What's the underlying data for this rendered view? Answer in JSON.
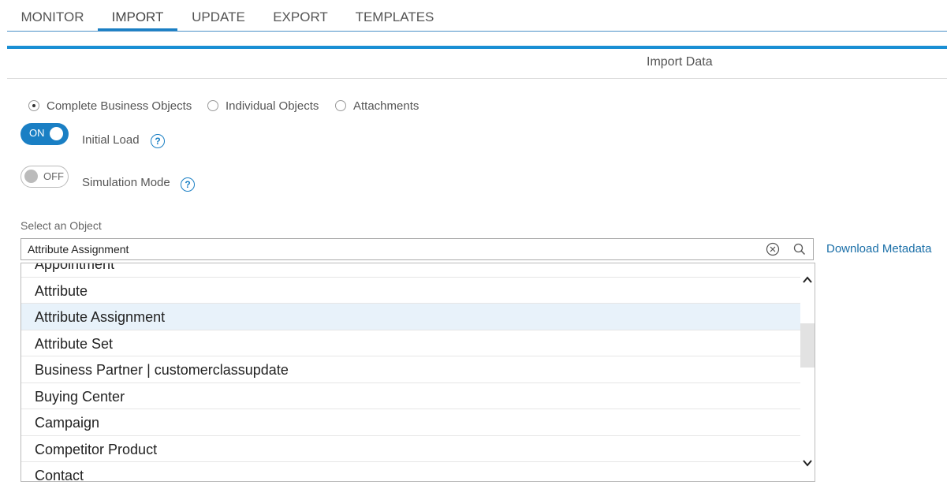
{
  "tabs": [
    {
      "label": "MONITOR"
    },
    {
      "label": "IMPORT",
      "active": true
    },
    {
      "label": "UPDATE"
    },
    {
      "label": "EXPORT"
    },
    {
      "label": "TEMPLATES"
    }
  ],
  "section_title": "Import Data",
  "import_types": [
    {
      "label": "Complete Business Objects",
      "selected": true
    },
    {
      "label": "Individual Objects",
      "selected": false
    },
    {
      "label": "Attachments",
      "selected": false
    }
  ],
  "initial_load": {
    "state": "ON",
    "label": "Initial Load",
    "help": "?"
  },
  "simulation_mode": {
    "state": "OFF",
    "label": "Simulation Mode",
    "help": "?"
  },
  "object_select": {
    "label": "Select an Object",
    "value": "Attribute Assignment",
    "download_link": "Download Metadata",
    "items": [
      "Appointment",
      "Attribute",
      "Attribute Assignment",
      "Attribute Set",
      "Business Partner | customerclassupdate",
      "Buying Center",
      "Campaign",
      "Competitor Product",
      "Contact"
    ],
    "selected_item": "Attribute Assignment"
  },
  "colors": {
    "accent": "#1a7fc4",
    "selected_row": "#e8f2fa",
    "link": "#1a6fa8"
  }
}
